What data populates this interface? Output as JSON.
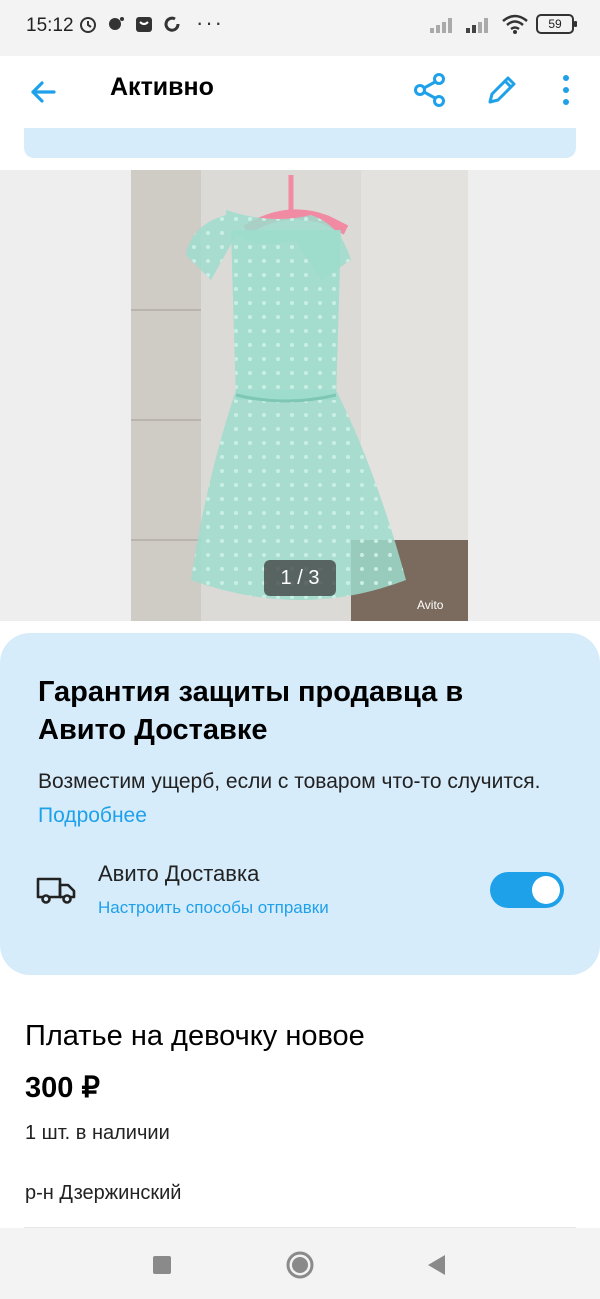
{
  "status_bar": {
    "time": "15:12",
    "battery": "59"
  },
  "app_bar": {
    "title": "Активно"
  },
  "gallery": {
    "counter": "1 / 3",
    "watermark": "Avito"
  },
  "guarantee": {
    "title": "Гарантия защиты продавца в Авито Доставке",
    "description": "Возместим ущерб, если с товаром что-то случится.",
    "link": "Подробнее",
    "delivery_title": "Авито Доставка",
    "delivery_subtitle": "Настроить способы отправки",
    "toggle_on": true
  },
  "item": {
    "title": "Платье на девочку новое",
    "price": "300 ₽",
    "stock": "1 шт. в наличии",
    "district": "р-н Дзержинский"
  },
  "colors": {
    "accent": "#1fa1ea",
    "card_bg": "#d7ecfb"
  }
}
